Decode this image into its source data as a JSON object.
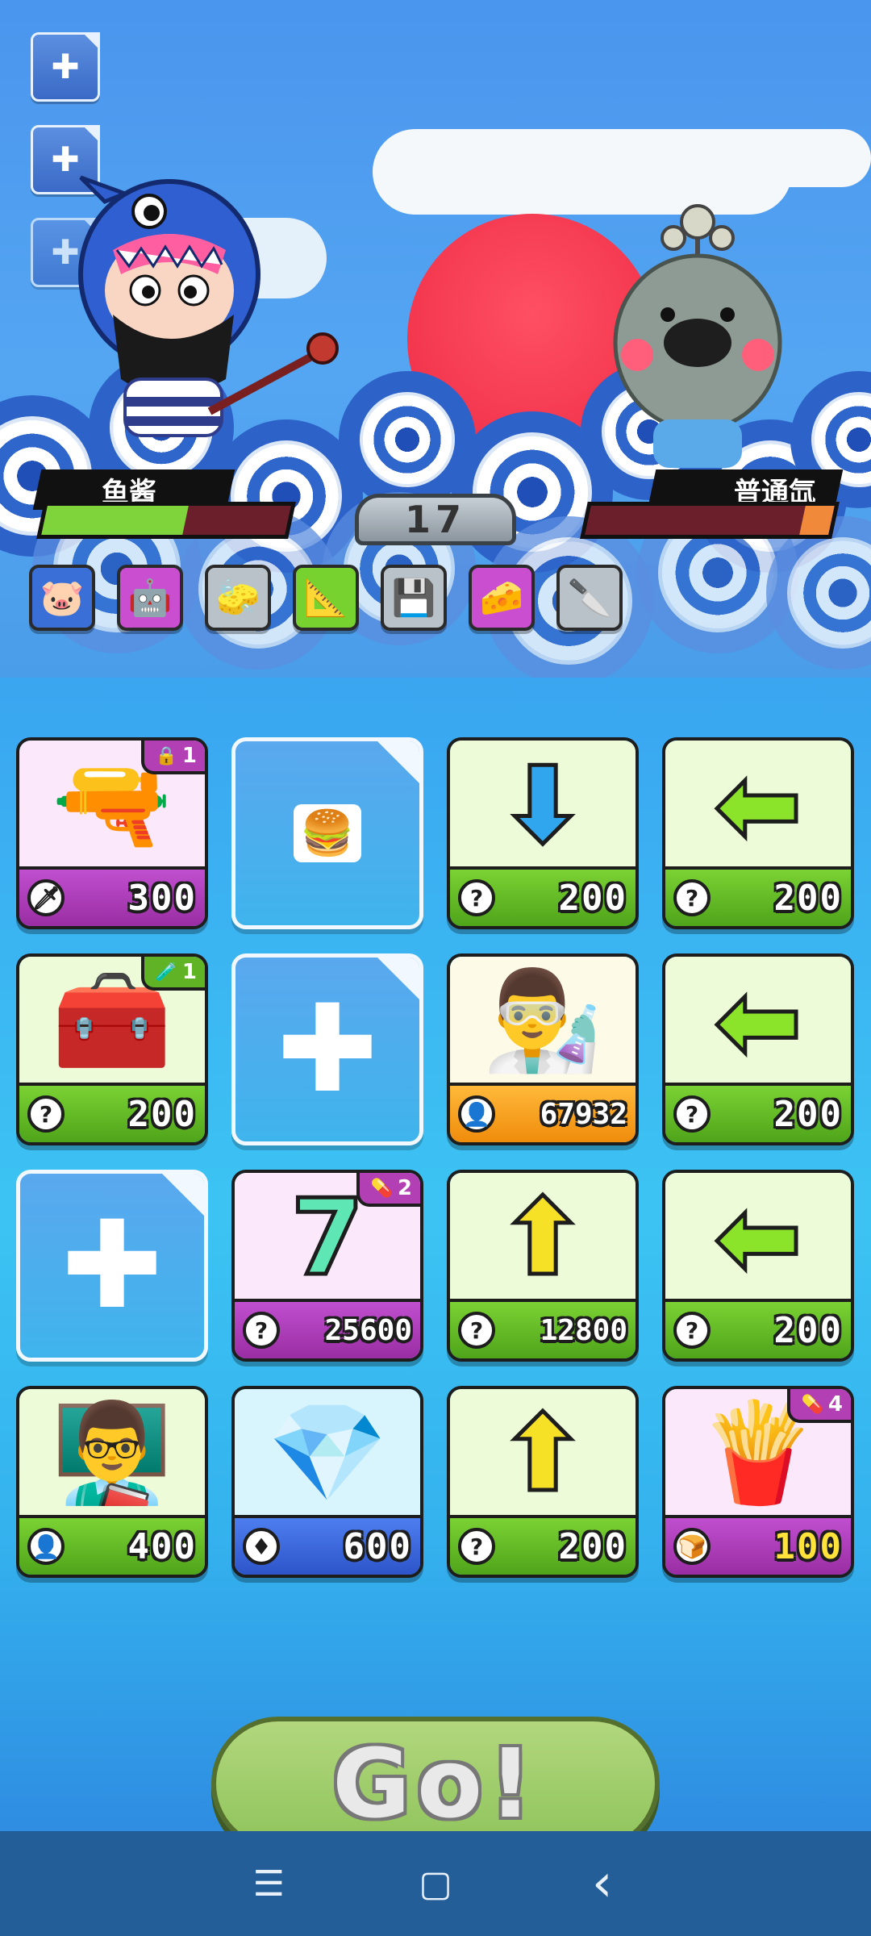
{
  "side_buttons": [
    {
      "icon": "plus-icon",
      "glyph": "✚"
    },
    {
      "icon": "plus-icon",
      "glyph": "✚"
    },
    {
      "icon": "plus-icon",
      "glyph": "✚"
    }
  ],
  "player": {
    "name": "鱼酱",
    "hp_fraction": 0.58,
    "hp_color": "#7ed43a"
  },
  "enemy": {
    "name": "普通氙",
    "hp_fraction": 0.12,
    "hp_color": "#f08a3a"
  },
  "turn": {
    "value": "17"
  },
  "items": [
    {
      "icon": "piggy-bank-icon",
      "glyph": "🐷",
      "color": "#3b6fd8"
    },
    {
      "icon": "robot-icon",
      "glyph": "🤖",
      "color": "#c94fd0"
    },
    {
      "icon": "eraser-icon",
      "glyph": "🧽",
      "color": "#b9c2c8"
    },
    {
      "icon": "set-square-icon",
      "glyph": "📐",
      "color": "#77d22f"
    },
    {
      "icon": "circuit-board-icon",
      "glyph": "💾",
      "color": "#b9c2c8"
    },
    {
      "icon": "cheese-icon",
      "glyph": "🧀",
      "color": "#c94fd0"
    },
    {
      "icon": "cleaver-icon",
      "glyph": "🔪",
      "color": "#b9c2c8"
    }
  ],
  "shop": [
    {
      "type": "card",
      "theme": "pink",
      "art_icon": "machine-gun-icon",
      "art": "🔫",
      "badge": {
        "icon": "lock-icon",
        "glyph": "🔒",
        "value": "1",
        "style": "pink"
      },
      "cost_icon": "sword-cost-icon",
      "cost_glyph": "🗡",
      "cost": "300",
      "gold": false
    },
    {
      "type": "slot",
      "content": "mini-card-icon",
      "glyph": "🍔"
    },
    {
      "type": "card",
      "theme": "green",
      "art_icon": "arrow-down-icon",
      "art": "⬇",
      "art_color": "#2fa6ee",
      "badge": null,
      "cost_icon": "question-icon",
      "cost_glyph": "?",
      "cost": "200",
      "gold": false
    },
    {
      "type": "card",
      "theme": "green",
      "art_icon": "arrow-left-icon",
      "art": "⬅",
      "art_color": "#8be42a",
      "badge": null,
      "cost_icon": "question-icon",
      "cost_glyph": "?",
      "cost": "200",
      "gold": false
    },
    {
      "type": "card",
      "theme": "green",
      "art_icon": "treasure-chest-icon",
      "art": "🧰",
      "badge": {
        "icon": "potion-icon",
        "glyph": "🧪",
        "value": "1",
        "style": "green"
      },
      "cost_icon": "question-icon",
      "cost_glyph": "?",
      "cost": "200",
      "gold": false
    },
    {
      "type": "slot",
      "content": "plus-icon",
      "glyph": "✚"
    },
    {
      "type": "card",
      "theme": "cream",
      "art_icon": "scientist-icon",
      "art": "👨‍🔬",
      "badge": null,
      "cost_icon": "person-cost-icon",
      "cost_glyph": "👤",
      "cost": "67932",
      "gold": false
    },
    {
      "type": "card",
      "theme": "green",
      "art_icon": "arrow-left-icon",
      "art": "⬅",
      "art_color": "#8be42a",
      "badge": null,
      "cost_icon": "question-icon",
      "cost_glyph": "?",
      "cost": "200",
      "gold": false
    },
    {
      "type": "slot",
      "content": "plus-icon",
      "glyph": "✚"
    },
    {
      "type": "card",
      "theme": "pink",
      "art_icon": "number-seven-icon",
      "art": "7",
      "art_color": "#5ee6b4",
      "badge": {
        "icon": "pill-icon",
        "glyph": "💊",
        "value": "2",
        "style": "pink"
      },
      "cost_icon": "question-icon",
      "cost_glyph": "?",
      "cost": "25600",
      "gold": false
    },
    {
      "type": "card",
      "theme": "green",
      "art_icon": "arrow-up-icon",
      "art": "⬆",
      "art_color": "#f7e126",
      "badge": null,
      "cost_icon": "question-icon",
      "cost_glyph": "?",
      "cost": "12800",
      "gold": false
    },
    {
      "type": "card",
      "theme": "green",
      "art_icon": "arrow-left-icon",
      "art": "⬅",
      "art_color": "#8be42a",
      "badge": null,
      "cost_icon": "question-icon",
      "cost_glyph": "?",
      "cost": "200",
      "gold": false
    },
    {
      "type": "card",
      "theme": "green",
      "art_icon": "teacher-icon",
      "art": "👨‍🏫",
      "badge": null,
      "cost_icon": "person-cost-icon",
      "cost_glyph": "👤",
      "cost": "400",
      "gold": false
    },
    {
      "type": "card",
      "theme": "blue",
      "art_icon": "gem-icon",
      "art": "💎",
      "badge": null,
      "cost_icon": "diamond-cost-icon",
      "cost_glyph": "♦",
      "cost": "600",
      "gold": false
    },
    {
      "type": "card",
      "theme": "green",
      "art_icon": "arrow-up-icon",
      "art": "⬆",
      "art_color": "#f7e126",
      "badge": null,
      "cost_icon": "question-icon",
      "cost_glyph": "?",
      "cost": "200",
      "gold": false
    },
    {
      "type": "card",
      "theme": "pink",
      "art_icon": "french-fries-icon",
      "art": "🍟",
      "badge": {
        "icon": "pill-icon",
        "glyph": "💊",
        "value": "4",
        "style": "pink"
      },
      "cost_icon": "bread-cost-icon",
      "cost_glyph": "🍞",
      "cost": "100",
      "gold": true
    }
  ],
  "go_button": {
    "label": "Go!"
  },
  "navbar": [
    {
      "icon": "menu-icon",
      "glyph": "☰"
    },
    {
      "icon": "home-square-icon",
      "glyph": "▢"
    },
    {
      "icon": "back-chevron-icon",
      "glyph": "‹"
    }
  ]
}
